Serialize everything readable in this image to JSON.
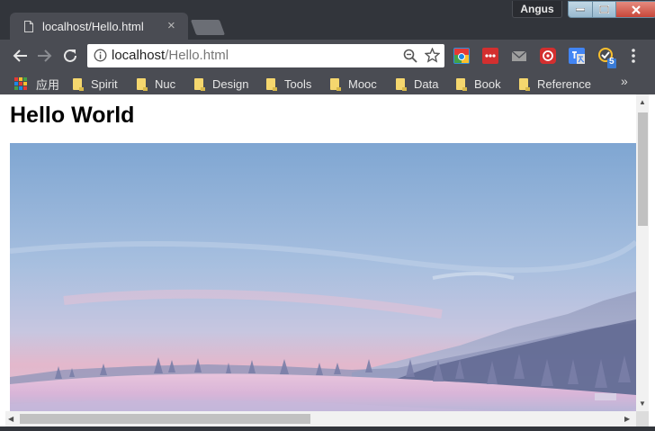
{
  "window": {
    "profile_name": "Angus"
  },
  "tab": {
    "title": "localhost/Hello.html",
    "close_glyph": "×"
  },
  "address_bar": {
    "host": "localhost",
    "path": "/Hello.html"
  },
  "bookmarks": {
    "apps_label": "应用",
    "items": [
      "Spirit",
      "Nuc",
      "Design",
      "Tools",
      "Mooc",
      "Data",
      "Book",
      "Reference"
    ],
    "overflow_glyph": "»"
  },
  "extensions": [
    "chrome-store-icon",
    "lastpass-icon",
    "mail-icon",
    "weibo-icon",
    "google-translate-icon",
    "checker-icon"
  ],
  "extension_badge": "5",
  "page": {
    "heading": "Hello World"
  },
  "colors": {
    "chrome_dark": "#32353b",
    "toolbar": "#4a4c53",
    "folder": "#f5d76e"
  }
}
